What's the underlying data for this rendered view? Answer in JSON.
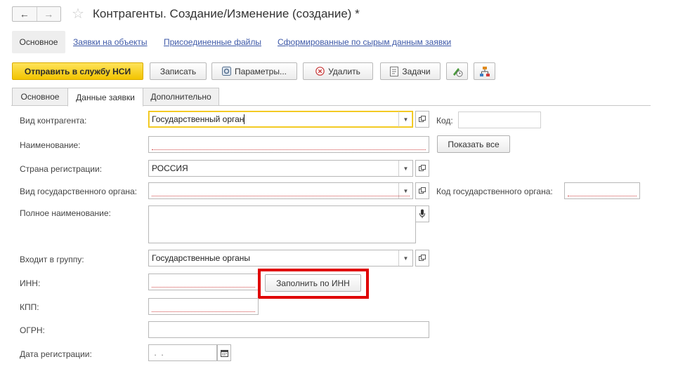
{
  "window": {
    "title": "Контрагенты. Создание/Изменение (создание) *"
  },
  "nav": {
    "active": "Основное",
    "links": [
      "Заявки на объекты",
      "Присоединенные файлы",
      "Сформированные по сырым данным заявки"
    ]
  },
  "toolbar": {
    "send_label": "Отправить в службу НСИ",
    "save_label": "Записать",
    "params_label": "Параметры...",
    "delete_label": "Удалить",
    "tasks_label": "Задачи"
  },
  "tabs": [
    {
      "label": "Основное",
      "active": false
    },
    {
      "label": "Данные заявки",
      "active": true
    },
    {
      "label": "Дополнительно",
      "active": false
    }
  ],
  "form": {
    "kind": {
      "label": "Вид контрагента:",
      "value": "Государственный орган"
    },
    "code": {
      "label": "Код:",
      "value": ""
    },
    "name": {
      "label": "Наименование:",
      "value": "",
      "button": "Показать все"
    },
    "country": {
      "label": "Страна регистрации:",
      "value": "РОССИЯ"
    },
    "gov_kind": {
      "label": "Вид государственного органа:",
      "value": ""
    },
    "gov_code": {
      "label": "Код государственного органа:",
      "value": ""
    },
    "full_name": {
      "label": "Полное наименование:",
      "value": ""
    },
    "group": {
      "label": "Входит в группу:",
      "value": "Государственные органы"
    },
    "inn": {
      "label": "ИНН:",
      "value": "",
      "button": "Заполнить по ИНН"
    },
    "kpp": {
      "label": "КПП:",
      "value": ""
    },
    "ogrn": {
      "label": "ОГРН:",
      "value": ""
    },
    "reg_date": {
      "label": "Дата регистрации:",
      "value": " .  ."
    }
  },
  "colors": {
    "accent_yellow": "#f2c400",
    "link": "#3e59a8",
    "highlight": "#e00000",
    "required_underline": "#d04040"
  },
  "icons": [
    "back-arrow-icon",
    "forward-arrow-icon",
    "star-icon",
    "settings-icon",
    "delete-icon",
    "tasks-icon",
    "edit-clock-icon",
    "structure-icon",
    "dropdown-arrow-icon",
    "open-icon",
    "microphone-icon",
    "calendar-icon"
  ]
}
